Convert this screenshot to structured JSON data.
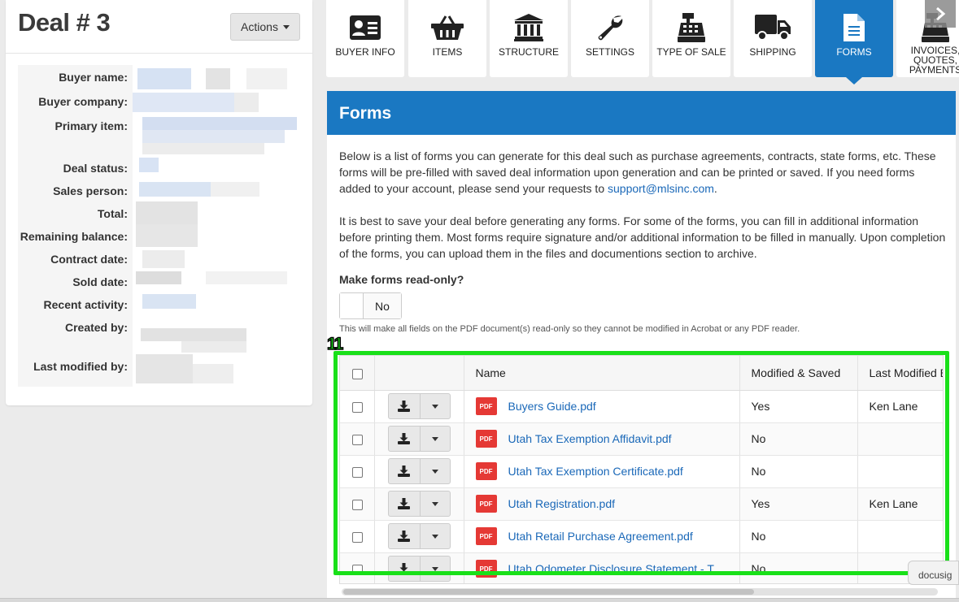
{
  "deal": {
    "title": "Deal # 3",
    "actions_label": "Actions"
  },
  "info_labels": {
    "buyer_name": "Buyer name:",
    "buyer_company": "Buyer company:",
    "primary_item": "Primary item:",
    "deal_status": "Deal status:",
    "sales_person": "Sales person:",
    "total": "Total:",
    "remaining_balance": "Remaining balance:",
    "contract_date": "Contract date:",
    "sold_date": "Sold date:",
    "recent_activity": "Recent activity:",
    "created_by": "Created by:",
    "last_modified_by": "Last modified by:"
  },
  "tabs": [
    {
      "label": "BUYER INFO",
      "icon": "id-card-icon"
    },
    {
      "label": "ITEMS",
      "icon": "basket-icon"
    },
    {
      "label": "STRUCTURE",
      "icon": "bank-icon"
    },
    {
      "label": "SETTINGS",
      "icon": "wrench-icon"
    },
    {
      "label": "TYPE OF SALE",
      "icon": "cash-register-icon"
    },
    {
      "label": "SHIPPING",
      "icon": "truck-icon"
    },
    {
      "label": "FORMS",
      "icon": "document-icon",
      "active": true
    },
    {
      "label": "INVOICES, QUOTES, PAYMENTS",
      "icon": "cash-register-icon"
    }
  ],
  "forms": {
    "title": "Forms",
    "desc1_pre": "Below is a list of forms you can generate for this deal such as purchase agreements, contracts, state forms, etc. These forms will be pre-filled with saved deal information upon generation and can be printed or saved. If you need forms added to your account, please send your requests to ",
    "support_email": "support@mlsinc.com",
    "desc1_post": ".",
    "desc2": "It is best to save your deal before generating any forms. For some of the forms, you can fill in additional information before printing them. Most forms require signature and/or additional information to be filled in manually. Upon completion of the forms, you can upload them in the files and documentions section to archive.",
    "readonly_label": "Make forms read-only?",
    "readonly_state": "No",
    "readonly_note": "This will make all fields on the PDF document(s) read-only so they cannot be modified in Acrobat or any PDF reader."
  },
  "table": {
    "columns": {
      "name": "Name",
      "modified_saved": "Modified & Saved",
      "last_modified": "Last Modified B"
    },
    "pdf_badge": "PDF",
    "rows": [
      {
        "name": "Buyers Guide.pdf",
        "modified": "Yes",
        "last_modified_by": "Ken Lane"
      },
      {
        "name": "Utah Tax Exemption Affidavit.pdf",
        "modified": "No",
        "last_modified_by": ""
      },
      {
        "name": "Utah Tax Exemption Certificate.pdf",
        "modified": "No",
        "last_modified_by": ""
      },
      {
        "name": "Utah Registration.pdf",
        "modified": "Yes",
        "last_modified_by": "Ken Lane"
      },
      {
        "name": "Utah Retail Purchase Agreement.pdf",
        "modified": "No",
        "last_modified_by": ""
      },
      {
        "name": "Utah Odometer Disclosure Statement - T...",
        "modified": "No",
        "last_modified_by": ""
      }
    ]
  },
  "annotation": {
    "number": "11",
    "color": "#19e019"
  },
  "float_tab": {
    "label": "docusig"
  },
  "colors": {
    "accent": "#1a78c2",
    "link": "#1a68b8",
    "pdf_red": "#e53935"
  }
}
